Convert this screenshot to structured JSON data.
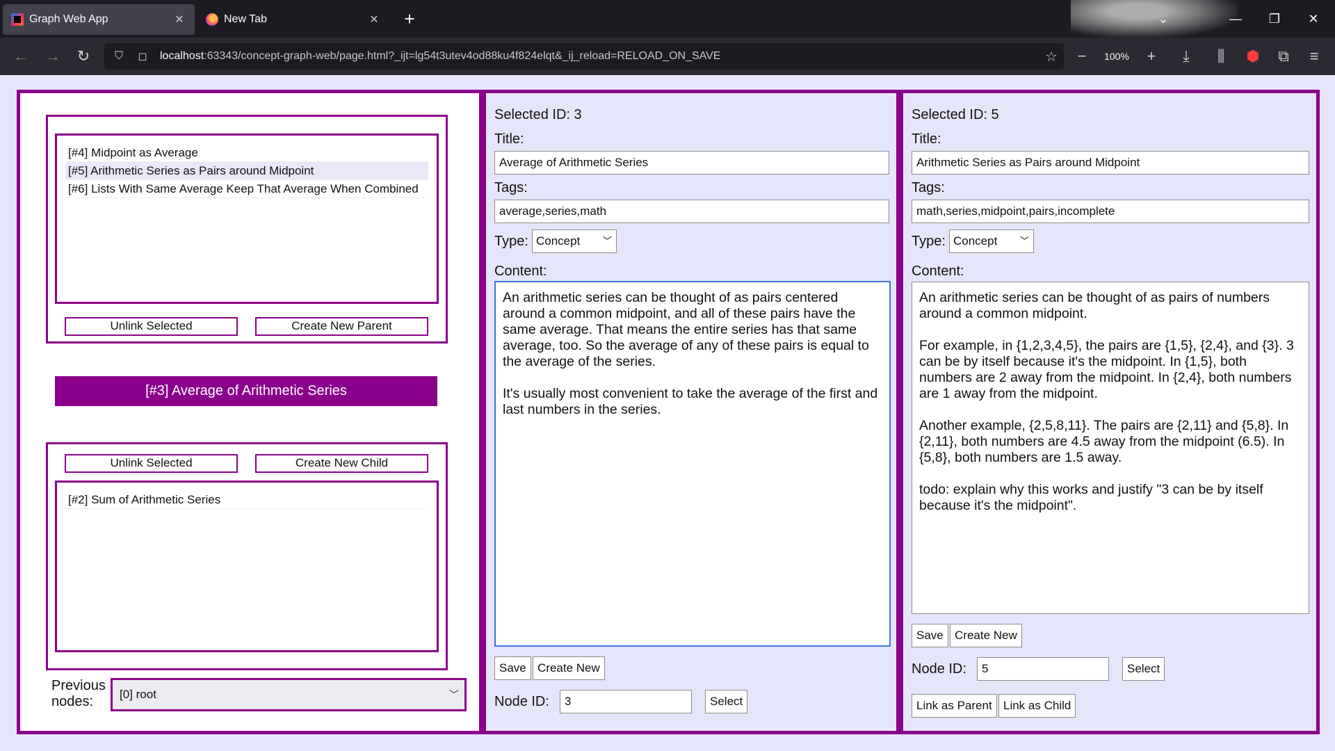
{
  "browser": {
    "tabs": [
      {
        "title": "Graph Web App",
        "active": true
      },
      {
        "title": "New Tab",
        "active": false
      }
    ],
    "url_host": "localhost",
    "url_rest": ":63343/concept-graph-web/page.html?_ijt=lg54t3utev4od88ku4f824elqt&_ij_reload=RELOAD_ON_SAVE",
    "zoom": "100%"
  },
  "left": {
    "parents": [
      {
        "label": "[#4] Midpoint as Average",
        "selected": false
      },
      {
        "label": "[#5] Arithmetic Series as Pairs around Midpoint",
        "selected": true
      },
      {
        "label": "[#6] Lists With Same Average Keep That Average When Combined",
        "selected": false
      }
    ],
    "unlink_parent_label": "Unlink Selected",
    "create_parent_label": "Create New Parent",
    "current_node": "[#3] Average of Arithmetic Series",
    "unlink_child_label": "Unlink Selected",
    "create_child_label": "Create New Child",
    "children": [
      {
        "label": "[#2] Sum of Arithmetic Series"
      }
    ],
    "previous_label": "Previous\nnodes:",
    "previous_value": "[0] root"
  },
  "middle": {
    "selected_id": "Selected ID: 3",
    "title_label": "Title:",
    "title_value": "Average of Arithmetic Series",
    "tags_label": "Tags:",
    "tags_value": "average,series,math",
    "type_label": "Type:",
    "type_value": "Concept",
    "content_label": "Content:",
    "content_value": "An arithmetic series can be thought of as pairs centered around a common midpoint, and all of these pairs have the same average. That means the entire series has that same average, too. So the average of any of these pairs is equal to the average of the series.\n\nIt's usually most convenient to take the average of the first and last numbers in the series.",
    "save_label": "Save",
    "create_new_label": "Create New",
    "node_id_label": "Node ID:",
    "node_id_value": "3",
    "select_label": "Select"
  },
  "right": {
    "selected_id": "Selected ID: 5",
    "title_label": "Title:",
    "title_value": "Arithmetic Series as Pairs around Midpoint",
    "tags_label": "Tags:",
    "tags_value": "math,series,midpoint,pairs,incomplete",
    "type_label": "Type:",
    "type_value": "Concept",
    "content_label": "Content:",
    "content_value": "An arithmetic series can be thought of as pairs of numbers around a common midpoint.\n\nFor example, in {1,2,3,4,5}, the pairs are {1,5}, {2,4}, and {3}. 3 can be by itself because it's the midpoint. In {1,5}, both numbers are 2 away from the midpoint. In {2,4}, both numbers are 1 away from the midpoint.\n\nAnother example, {2,5,8,11}. The pairs are {2,11} and {5,8}. In {2,11}, both numbers are 4.5 away from the midpoint (6.5). In {5,8}, both numbers are 1.5 away.\n\ntodo: explain why this works and justify \"3 can be by itself because it's the midpoint\".",
    "save_label": "Save",
    "create_new_label": "Create New",
    "node_id_label": "Node ID:",
    "node_id_value": "5",
    "select_label": "Select",
    "link_parent_label": "Link as Parent",
    "link_child_label": "Link as Child"
  }
}
